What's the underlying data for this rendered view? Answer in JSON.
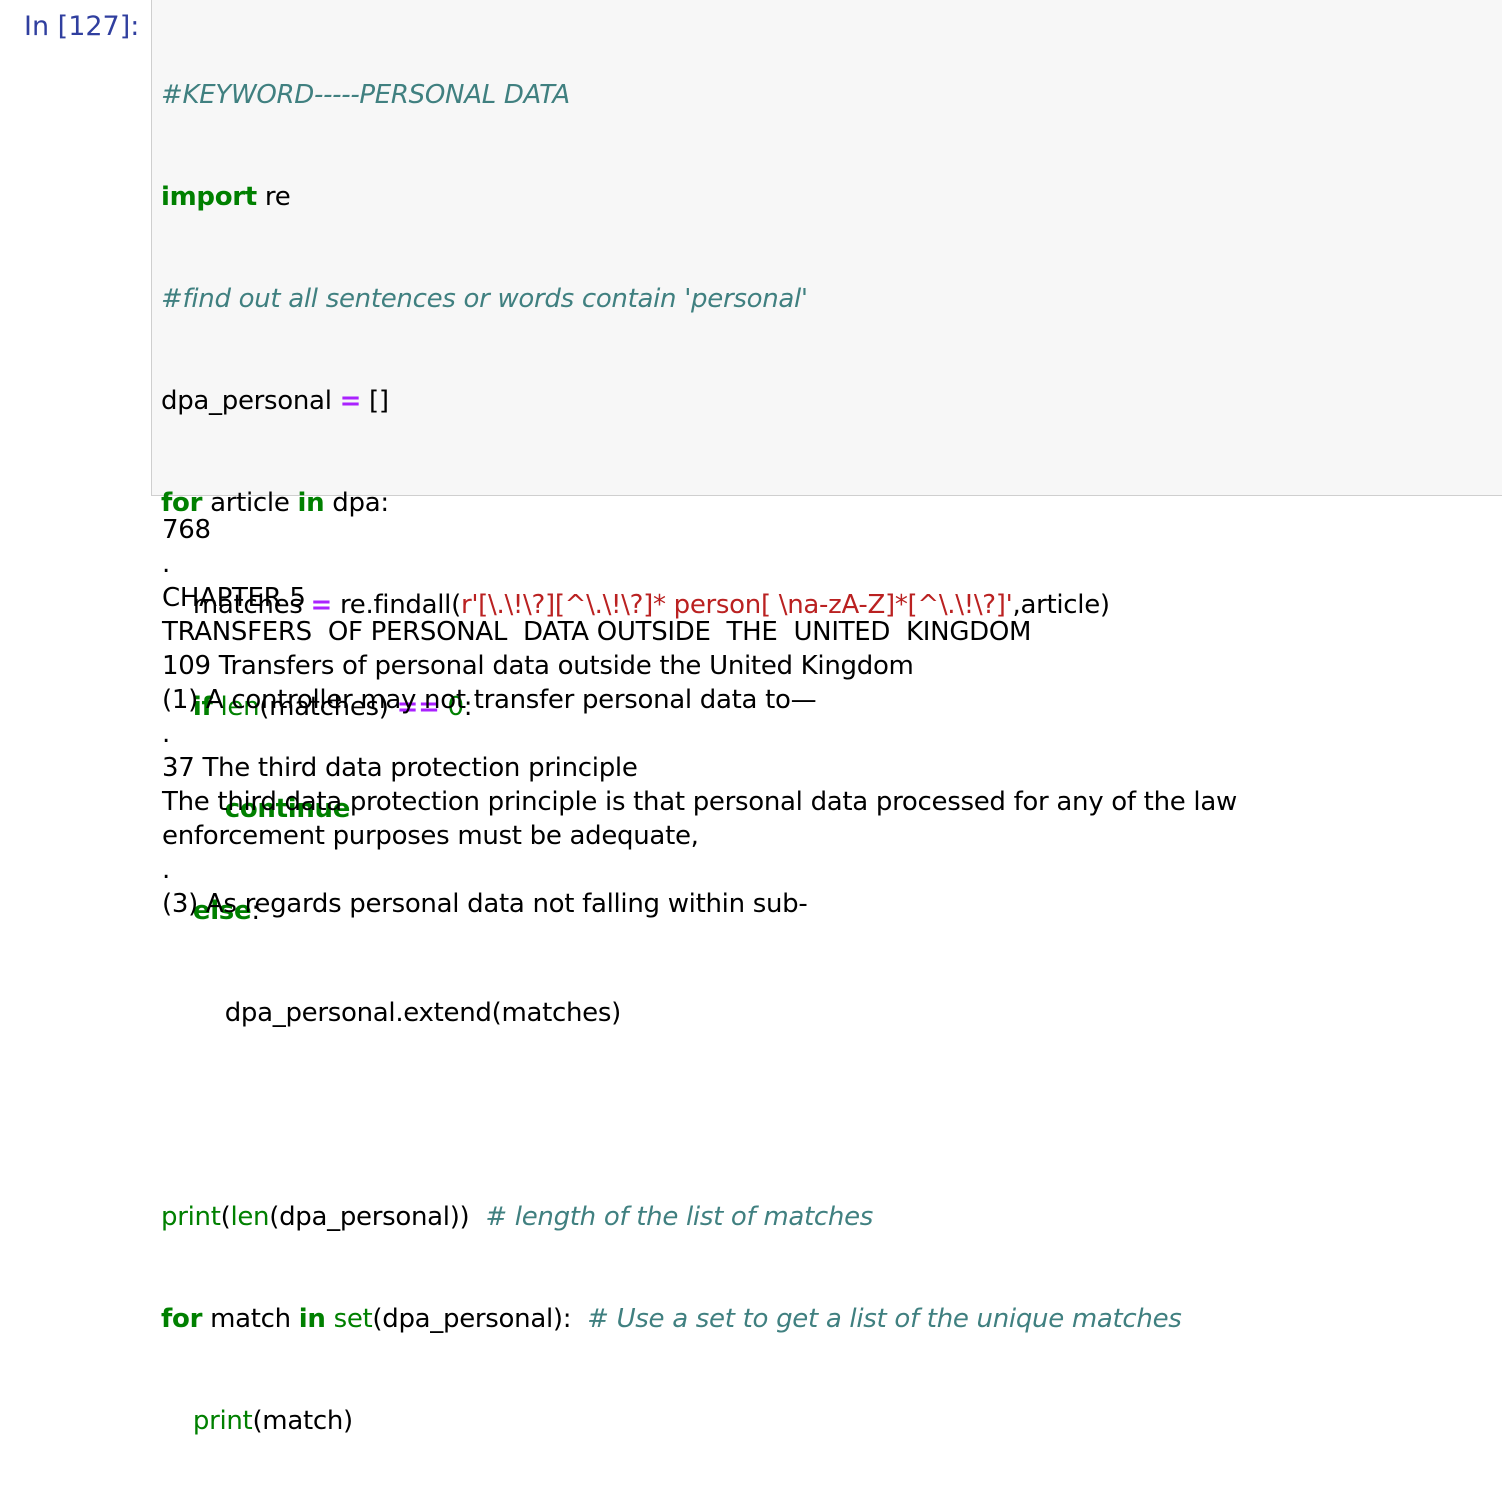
{
  "prompt_label": "In [127]:",
  "code": {
    "l1_comment": "#KEYWORD-----PERSONAL DATA",
    "l2_import": "import",
    "l2_module": " re",
    "l3_comment": "#find out all sentences or words contain 'personal'",
    "l4_var": "dpa_personal ",
    "l4_eq": "=",
    "l4_rest": " []",
    "l5_for": "for",
    "l5_mid": " article ",
    "l5_in": "in",
    "l5_rest": " dpa:",
    "l6_indent": "    ",
    "l6_var": "matches ",
    "l6_eq": "=",
    "l6_call": " re.findall(",
    "l6_str": "r'[\\.\\!\\?][^\\.\\!\\?]* person[ \\na-zA-Z]*[^\\.\\!\\?]'",
    "l6_rest": ",article)",
    "l7_indent": "    ",
    "l7_if": "if",
    "l7_sp": " ",
    "l7_len": "len",
    "l7_arg": "(matches) ",
    "l7_eqeq": "==",
    "l7_sp2": " ",
    "l7_zero": "0",
    "l7_colon": ":",
    "l8_indent": "        ",
    "l8_continue": "continue",
    "l9_indent": "    ",
    "l9_else": "else",
    "l9_colon": ":",
    "l10_text": "        dpa_personal.extend(matches)",
    "l12_print": "print",
    "l12_p1": "(",
    "l12_len": "len",
    "l12_p2": "(dpa_personal))  ",
    "l12_comment": "# length of the list of matches",
    "l13_for": "for",
    "l13_mid": " match ",
    "l13_in": "in",
    "l13_sp": " ",
    "l13_set": "set",
    "l13_rest": "(dpa_personal):  ",
    "l13_comment": "# Use a set to get a list of the unique matches",
    "l14_indent": "    ",
    "l14_print": "print",
    "l14_rest": "(match)"
  },
  "output_lines": [
    "768",
    ".",
    "CHAPTER 5",
    "TRANSFERS  OF PERSONAL  DATA OUTSIDE  THE  UNITED  KINGDOM",
    "109 Transfers of personal data outside the United Kingdom",
    "(1) A controller may not transfer personal data to—",
    ".",
    "37 The third data protection principle",
    "The third data protection principle is that personal data processed for any of the law",
    "enforcement purposes must be adequate,",
    ".",
    "(3) As regards personal data not falling within sub-"
  ],
  "colors": {
    "prompt": "#303f9f",
    "keyword": "#008000",
    "operator": "#aa22ff",
    "string": "#ba2121",
    "comment": "#408080",
    "cell_background": "#f7f7f7"
  }
}
